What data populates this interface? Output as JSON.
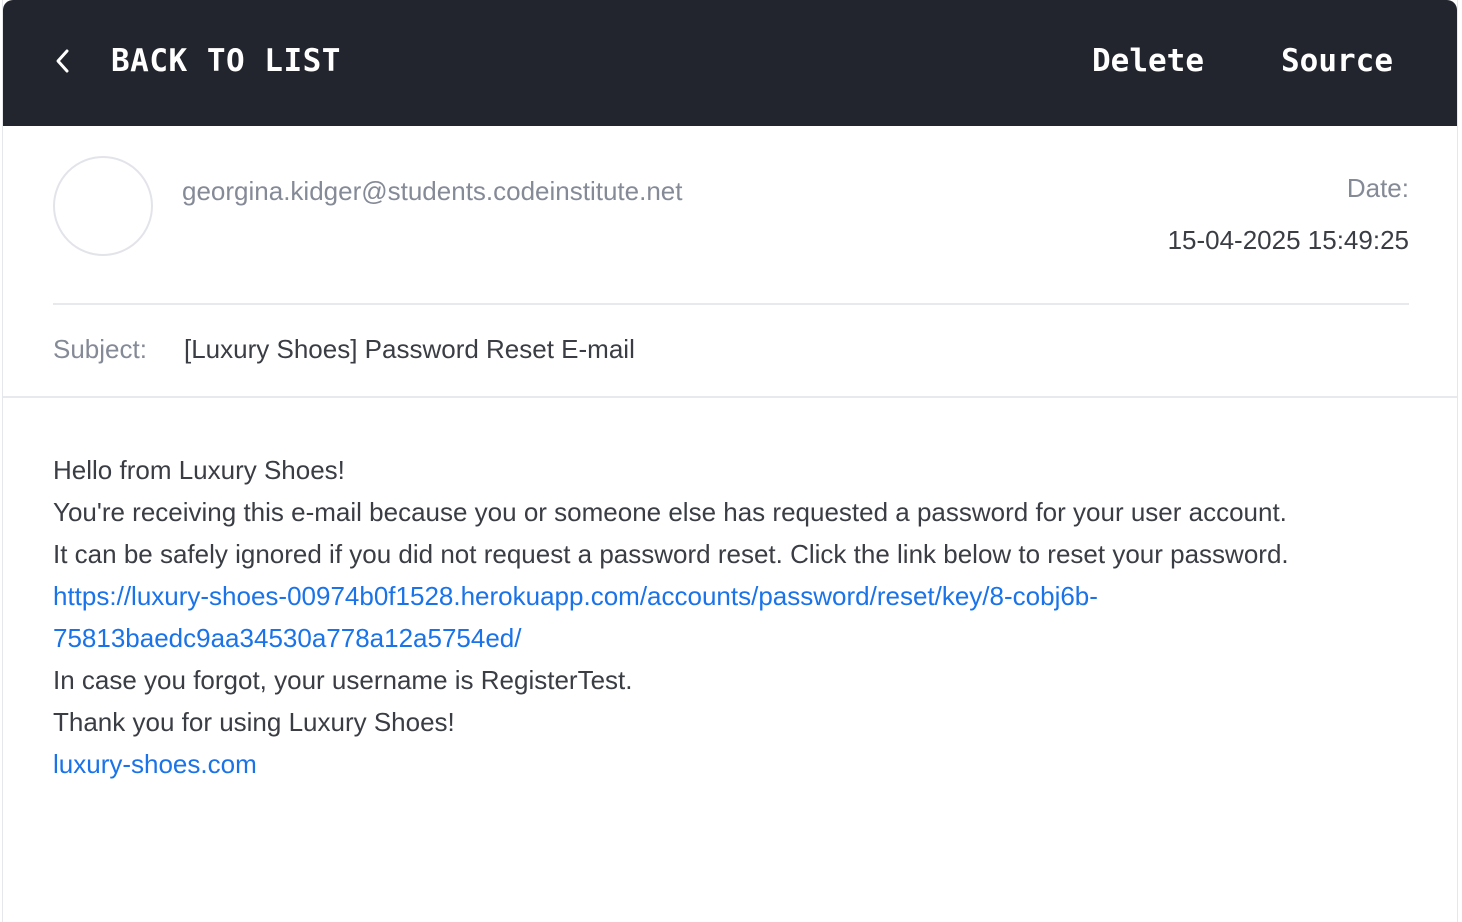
{
  "topbar": {
    "back_label": "BACK TO LIST",
    "back_icon": "chevron-left-icon",
    "delete_label": "Delete",
    "source_label": "Source",
    "background_color": "#22252d"
  },
  "message": {
    "sender": "georgina.kidger@students.codeinstitute.net",
    "date_label": "Date:",
    "date_value": "15-04-2025 15:49:25",
    "subject_label": "Subject:",
    "subject_value": "[Luxury Shoes] Password Reset E-mail"
  },
  "body": {
    "greeting": "Hello from Luxury Shoes!",
    "line_1": "You're receiving this e-mail because you or someone else has requested a password for your user account.",
    "line_2": "It can be safely ignored if you did not request a password reset. Click the link below to reset your password.",
    "reset_link_part_1": "https://luxury-shoes-00974b0f1528.herokuapp.com/accounts/password/reset/key/8-cobj6b-",
    "reset_link_part_2": "75813baedc9aa34530a778a12a5754ed/",
    "line_3": "In case you forgot, your username is RegisterTest.",
    "line_4": "Thank you for using Luxury Shoes!",
    "site_link": "luxury-shoes.com",
    "link_color": "#1a73e8"
  }
}
